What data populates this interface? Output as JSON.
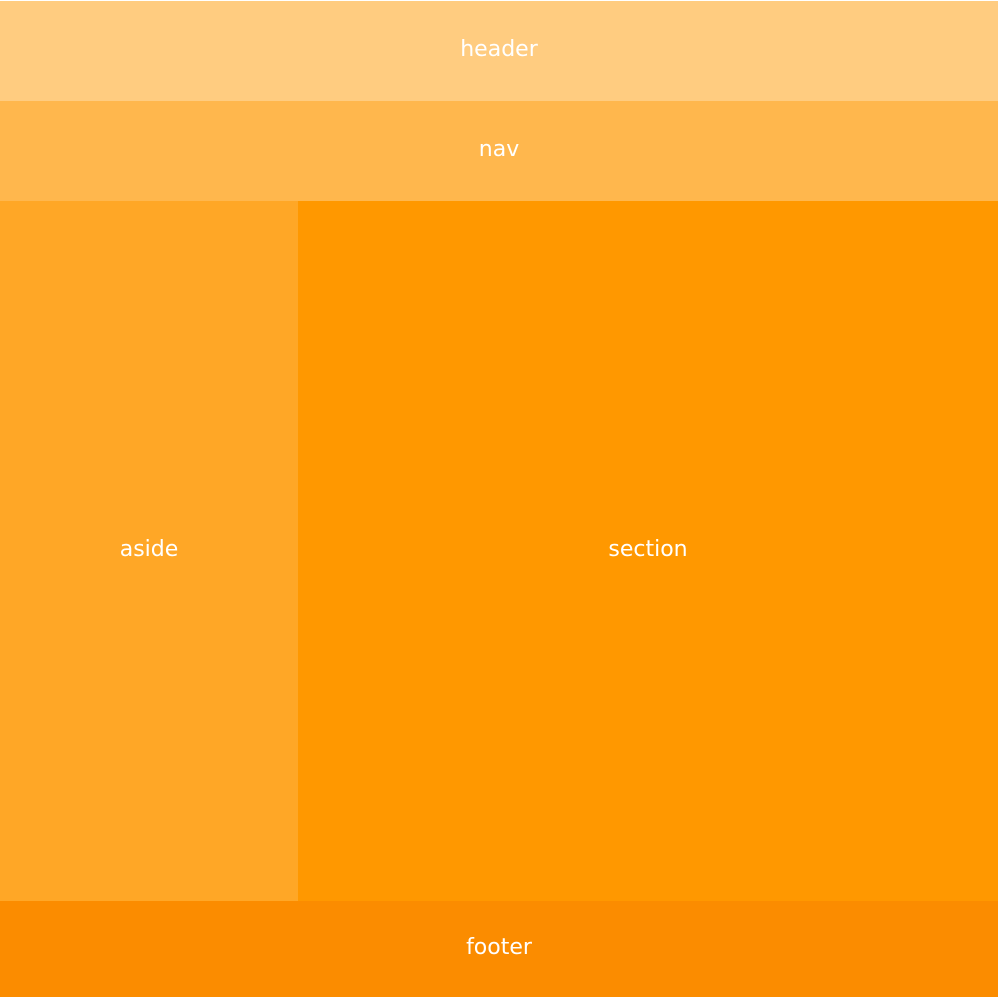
{
  "layout": {
    "header": {
      "label": "header",
      "color": "#FFCC80"
    },
    "nav": {
      "label": "nav",
      "color": "#FFB74D"
    },
    "aside": {
      "label": "aside",
      "color": "#FFA726"
    },
    "section": {
      "label": "section",
      "color": "#FF9800"
    },
    "footer": {
      "label": "footer",
      "color": "#FB8C00"
    }
  }
}
